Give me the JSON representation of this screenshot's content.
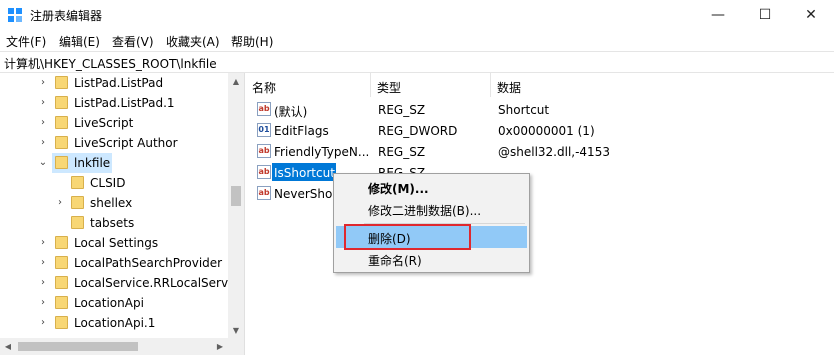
{
  "window": {
    "title": "注册表编辑器",
    "minimize_glyph": "—",
    "maximize_glyph": "☐",
    "close_glyph": "✕"
  },
  "menu": [
    "文件(F)",
    "编辑(E)",
    "查看(V)",
    "收藏夹(A)",
    "帮助(H)"
  ],
  "address": "计算机\\HKEY_CLASSES_ROOT\\lnkfile",
  "tree": [
    {
      "label": "ListPad.ListPad",
      "expander": "›"
    },
    {
      "label": "ListPad.ListPad.1",
      "expander": "›"
    },
    {
      "label": "LiveScript",
      "expander": "›"
    },
    {
      "label": "LiveScript Author",
      "expander": "›"
    },
    {
      "label": "lnkfile",
      "expander": "⌄"
    },
    {
      "label": "CLSID",
      "expander": ""
    },
    {
      "label": "shellex",
      "expander": "›"
    },
    {
      "label": "tabsets",
      "expander": ""
    },
    {
      "label": "Local Settings",
      "expander": "›"
    },
    {
      "label": "LocalPathSearchProvider",
      "expander": "›"
    },
    {
      "label": "LocalService.RRLocalServic",
      "expander": "›"
    },
    {
      "label": "LocationApi",
      "expander": "›"
    },
    {
      "label": "LocationApi.1",
      "expander": "›"
    }
  ],
  "columns": {
    "name": "名称",
    "type": "类型",
    "data": "数据"
  },
  "values": [
    {
      "name": "(默认)",
      "type": "REG_SZ",
      "data": "Shortcut",
      "icon": "ab",
      "icon_name": "string-value-icon"
    },
    {
      "name": "EditFlags",
      "type": "REG_DWORD",
      "data": "0x00000001 (1)",
      "icon": "01",
      "icon_name": "binary-value-icon"
    },
    {
      "name": "FriendlyTypeN...",
      "type": "REG_SZ",
      "data": "@shell32.dll,-4153",
      "icon": "ab",
      "icon_name": "string-value-icon"
    },
    {
      "name": "IsShortcut",
      "type": "REG_SZ",
      "data": "",
      "icon": "ab",
      "icon_name": "string-value-icon"
    },
    {
      "name": "NeverShow",
      "type": "",
      "data": "",
      "icon": "ab",
      "icon_name": "string-value-icon"
    }
  ],
  "context_menu": {
    "modify": "修改(M)...",
    "modify_binary": "修改二进制数据(B)...",
    "delete": "删除(D)",
    "rename": "重命名(R)"
  },
  "colors": {
    "selection": "#0078d7",
    "menu_highlight": "#91c9f7",
    "annotation_box": "#e0282e"
  }
}
